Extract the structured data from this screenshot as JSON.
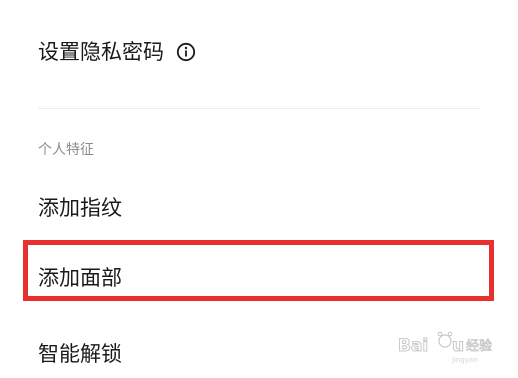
{
  "privacy_password": {
    "label": "设置隐私密码",
    "info_icon": "info-circle-icon"
  },
  "section": {
    "header": "个人特征"
  },
  "items": [
    {
      "label": "添加指纹"
    },
    {
      "label": "添加面部"
    },
    {
      "label": "智能解锁"
    }
  ],
  "highlight": {
    "color": "#e8312f"
  },
  "watermark": {
    "text": "Baidu 经验"
  }
}
